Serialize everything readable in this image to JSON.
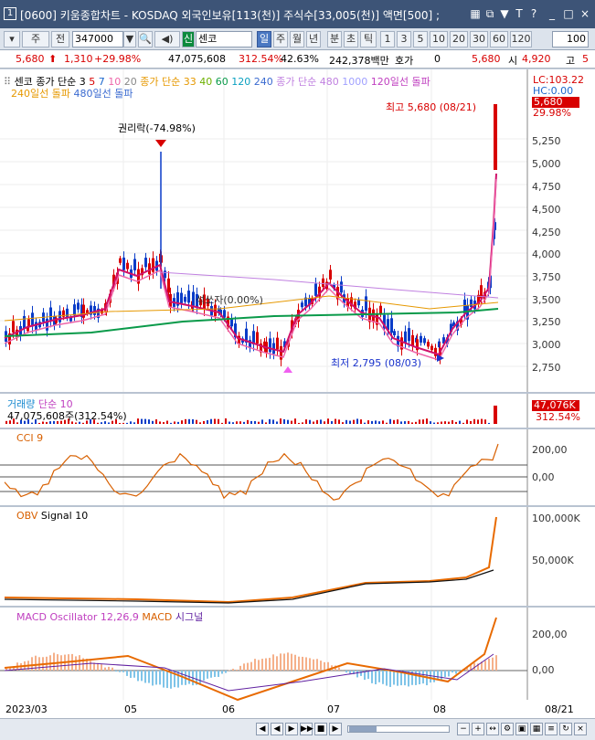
{
  "titlebar": {
    "num": "1",
    "title": "[0600] 키움종합차트 - KOSDAQ 외국인보유[113(천)] 주식수[33,005(천)] 액면[500] ;",
    "icons": [
      "grid-icon",
      "copy-icon",
      "pin-icon",
      "font-icon",
      "help-icon",
      "minimize-icon",
      "maximize-icon",
      "close-icon"
    ],
    "icon_glyphs": [
      "▦",
      "⧉",
      "▼",
      "T",
      "?",
      "_",
      "□",
      "×"
    ]
  },
  "toolbar": {
    "market": "주",
    "prev": "전",
    "code": "347000",
    "search_icon": "▼",
    "name_icon": "신",
    "name": "센코",
    "periods": [
      "일",
      "주",
      "월",
      "년",
      "분",
      "초",
      "틱"
    ],
    "numbers": [
      "1",
      "3",
      "5",
      "10",
      "20",
      "30",
      "60",
      "120"
    ],
    "count": "100"
  },
  "quote": {
    "price": "5,680",
    "change": "1,310",
    "pct": "+29.98%",
    "volume": "47,075,608",
    "vol_pct": "312.54%",
    "turnover_pct": "42.63%",
    "amount": "242,378백만",
    "hoga_label": "호가",
    "hoga_val": "0",
    "hoga_price": "5,680",
    "open_label": "시",
    "open_val": "4,920",
    "high_label": "고",
    "high_val": "5"
  },
  "price_pane": {
    "legend": [
      "센코",
      "종가 단순 3",
      "5",
      "7",
      "10",
      "20",
      "종가 단순 33",
      "40",
      "60",
      "120",
      "240",
      "종가 단순 480",
      "1000",
      "120일선 돌파",
      "240일선 돌파",
      "480일선 돌파"
    ],
    "lc": "LC:103.22",
    "hc": "HC:0.00",
    "high_note": "최고 5,680 (08/21)",
    "low_note": "최저 2,795 (08/03)",
    "rights_note": "권리락(-74.98%)",
    "cross_note": "섞쏘자(0.00%)",
    "last_price": "5,680",
    "last_pct": "29.98%",
    "ticks": [
      "5,250",
      "5,000",
      "4,750",
      "4,500",
      "4,250",
      "4,000",
      "3,750",
      "3,500",
      "3,250",
      "3,000",
      "2,750"
    ]
  },
  "volume_pane": {
    "title": "거래량",
    "ma": "단순 10",
    "value": "47,075,608주(312.54%)",
    "tag": "47,076K",
    "tag_pct": "312.54%"
  },
  "cci_pane": {
    "title": "CCI 9",
    "ticks": [
      "200,00",
      "0,00"
    ]
  },
  "obv_pane": {
    "title": "OBV",
    "signal": "Signal 10",
    "ticks": [
      "100,000K",
      "50,000K"
    ]
  },
  "macd_pane": {
    "title": "MACD Oscillator 12,26,9",
    "macd": "MACD",
    "signal": "시그널",
    "ticks": [
      "200,00",
      "0,00"
    ]
  },
  "xaxis": {
    "labels": [
      "2023/03",
      "05",
      "06",
      "07",
      "08"
    ],
    "right": "08/21"
  },
  "footer": {
    "buttons": [
      "◀",
      "◀",
      "▶",
      "▶▶",
      "■",
      "▶"
    ]
  }
}
